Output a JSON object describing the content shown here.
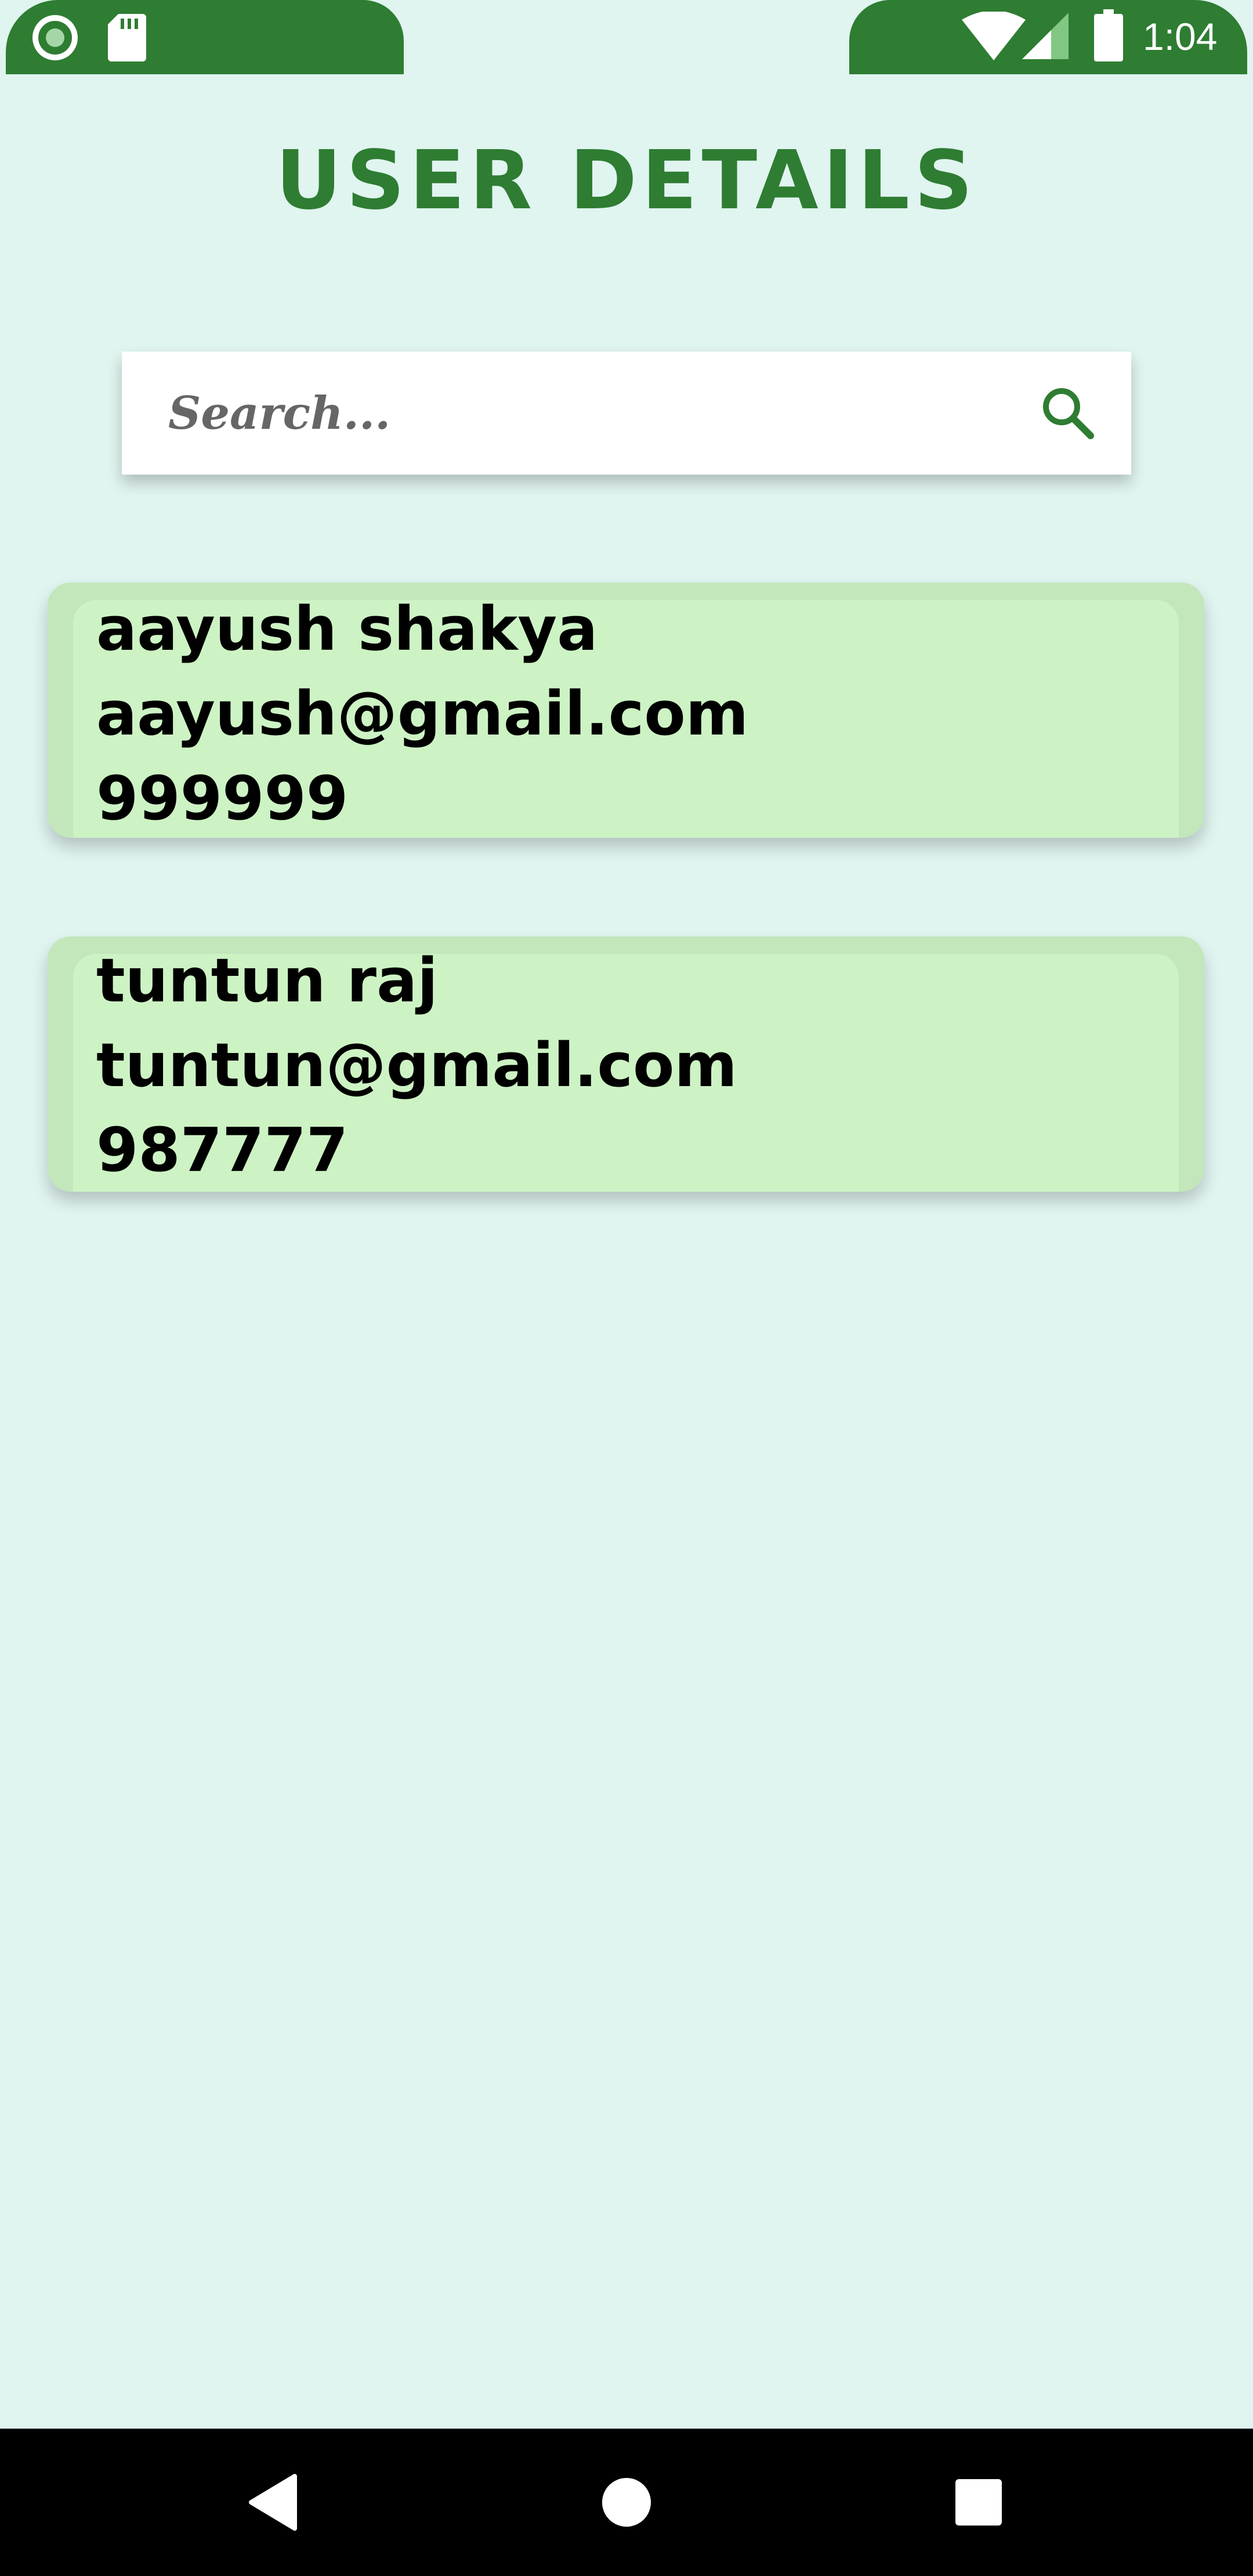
{
  "status_bar": {
    "time": "1:04",
    "color": "#2e7d32",
    "left_icons": [
      "radio-icon",
      "sd-card-icon"
    ],
    "right_icons": [
      "wifi-icon",
      "cellular-signal-icon",
      "battery-icon"
    ]
  },
  "title": "USER DETAILS",
  "search": {
    "placeholder": "Search...",
    "value": "",
    "icon": "search-icon"
  },
  "users": [
    {
      "name": "aayush shakya",
      "email": "aayush@gmail.com",
      "phone": "999999"
    },
    {
      "name": "tuntun raj",
      "email": "tuntun@gmail.com",
      "phone": "987777"
    }
  ],
  "nav_bar": {
    "buttons": [
      "back-icon",
      "home-icon",
      "recents-icon"
    ]
  },
  "colors": {
    "accent": "#2e7d32",
    "background": "#e0f4f0",
    "card": "#cdf3c4",
    "card_border": "#c3e6bb"
  }
}
